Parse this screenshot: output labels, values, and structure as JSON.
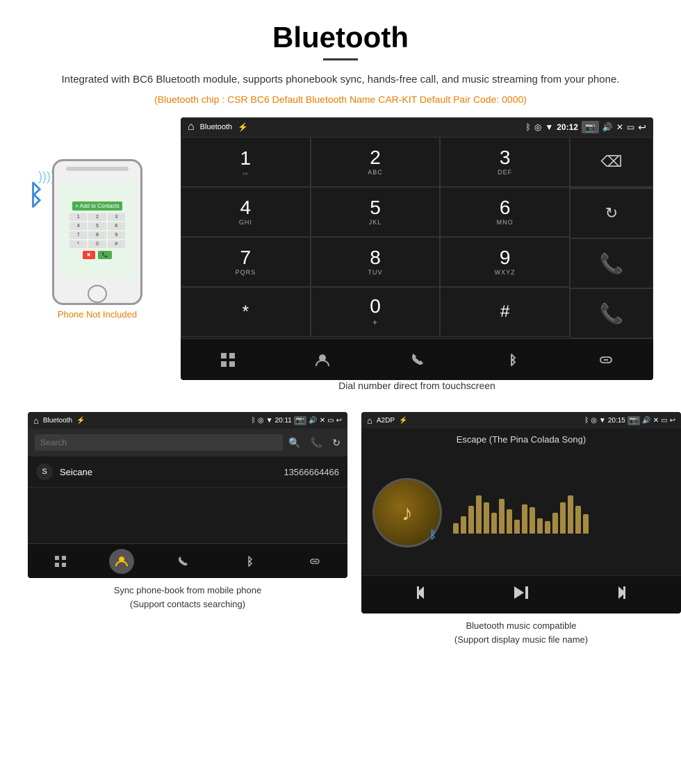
{
  "page": {
    "title": "Bluetooth",
    "subtitle": "Integrated with BC6 Bluetooth module, supports phonebook sync, hands-free call, and music streaming from your phone.",
    "orange_info": "(Bluetooth chip : CSR BC6    Default Bluetooth Name CAR-KIT    Default Pair Code: 0000)",
    "dial_caption": "Dial number direct from touchscreen",
    "phonebook_caption_line1": "Sync phone-book from mobile phone",
    "phonebook_caption_line2": "(Support contacts searching)",
    "music_caption_line1": "Bluetooth music compatible",
    "music_caption_line2": "(Support display music file name)"
  },
  "main_screen": {
    "status_bar": {
      "title": "Bluetooth",
      "time": "20:12"
    },
    "dialpad": {
      "keys": [
        {
          "num": "1",
          "sub": ""
        },
        {
          "num": "2",
          "sub": "ABC"
        },
        {
          "num": "3",
          "sub": "DEF"
        },
        {
          "num": "4",
          "sub": "GHI"
        },
        {
          "num": "5",
          "sub": "JKL"
        },
        {
          "num": "6",
          "sub": "MNO"
        },
        {
          "num": "7",
          "sub": "PQRS"
        },
        {
          "num": "8",
          "sub": "TUV"
        },
        {
          "num": "9",
          "sub": "WXYZ"
        },
        {
          "num": "*",
          "sub": ""
        },
        {
          "num": "0",
          "sub": "+"
        },
        {
          "num": "#",
          "sub": ""
        }
      ]
    }
  },
  "phonebook_screen": {
    "status_bar": {
      "title": "Bluetooth",
      "time": "20:11"
    },
    "search_placeholder": "Search",
    "contact": {
      "letter": "S",
      "name": "Seicane",
      "number": "13566664466"
    },
    "bottom_icons": [
      "grid",
      "person",
      "phone",
      "bluetooth",
      "link"
    ]
  },
  "music_screen": {
    "status_bar": {
      "title": "A2DP",
      "time": "20:15"
    },
    "song_title": "Escape (The Pina Colada Song)",
    "eq_bars": [
      15,
      25,
      40,
      55,
      45,
      30,
      50,
      35,
      20,
      42,
      38,
      22,
      18,
      30,
      45,
      55,
      40,
      28
    ]
  },
  "phone_label": "Phone Not Included",
  "icons": {
    "backspace": "⌫",
    "call_green": "📞",
    "call_red": "📵",
    "reload": "↺",
    "grid": "⊞",
    "person": "👤",
    "phone": "📞",
    "bluetooth": "ᛒ",
    "link": "🔗",
    "prev": "⏮",
    "play": "⏯",
    "next": "⏭"
  }
}
